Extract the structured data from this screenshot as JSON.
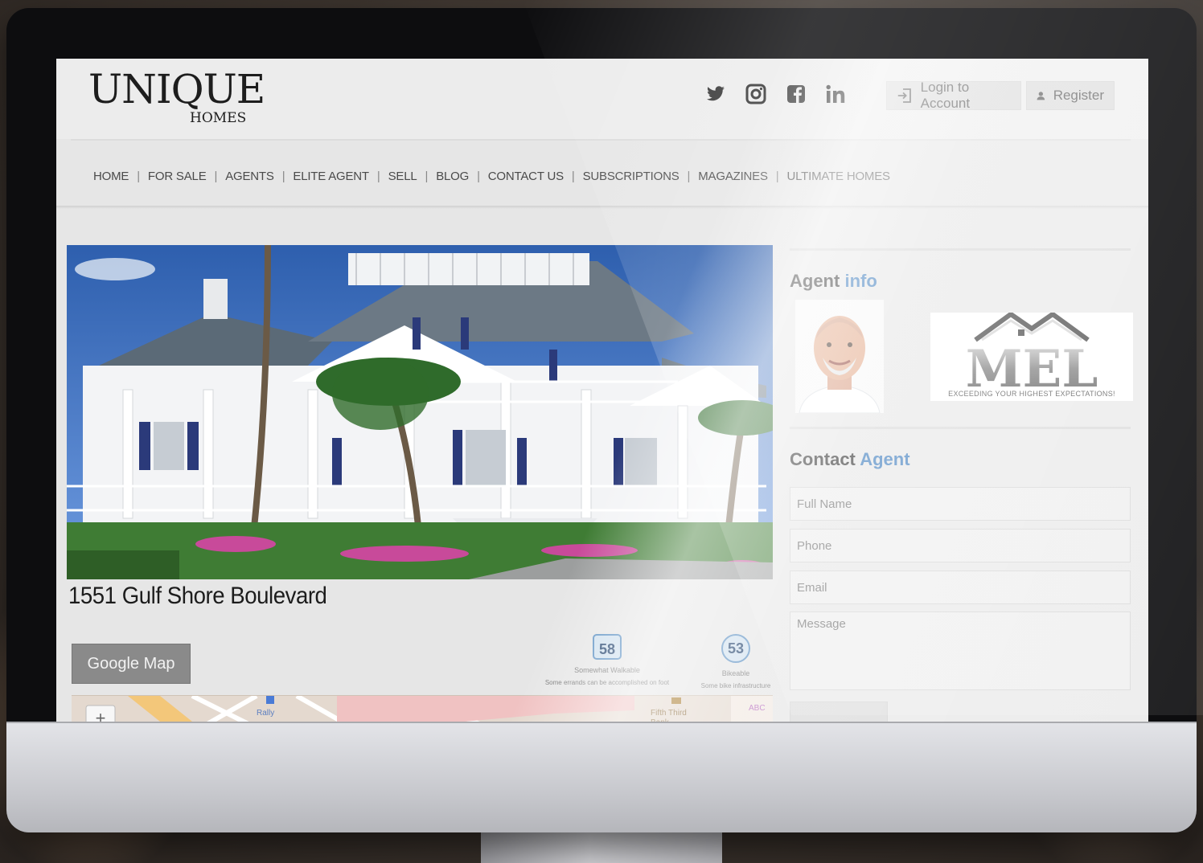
{
  "header": {
    "logo_main": "UNIQUE",
    "logo_sub": "HOMES",
    "social_icons": [
      "twitter-icon",
      "instagram-icon",
      "facebook-icon",
      "linkedin-icon"
    ],
    "login_label": "Login to Account",
    "register_label": "Register"
  },
  "nav": {
    "items": [
      "HOME",
      "FOR SALE",
      "AGENTS",
      "ELITE AGENT",
      "SELL",
      "BLOG",
      "CONTACT US",
      "SUBSCRIPTIONS",
      "MAGAZINES",
      "ULTIMATE HOMES"
    ]
  },
  "listing": {
    "address": "1551 Gulf Shore Boulevard",
    "map_button_label": "Google Map",
    "walk_score": {
      "value": "58",
      "title": "Somewhat Walkable",
      "desc": "Some errands can be accomplished on foot"
    },
    "bike_score": {
      "value": "53",
      "title": "Bikeable",
      "desc": "Some bike infrastructure"
    },
    "map_labels": [
      "Rally",
      "Fifth Third Bank",
      "ABC"
    ]
  },
  "sidebar": {
    "agent_heading_prefix": "Agent",
    "agent_heading_accent": "info",
    "brand_letters": "MEL",
    "brand_tagline": "EXCEEDING YOUR HIGHEST EXPECTATIONS!",
    "contact_heading_prefix": "Contact",
    "contact_heading_accent": "Agent",
    "form": {
      "full_name_placeholder": "Full Name",
      "phone_placeholder": "Phone",
      "email_placeholder": "Email",
      "message_placeholder": "Message"
    }
  },
  "colors": {
    "accent": "#2e72b8",
    "nav_text": "#4a4a4a",
    "map_button": "#8a8a8a"
  }
}
